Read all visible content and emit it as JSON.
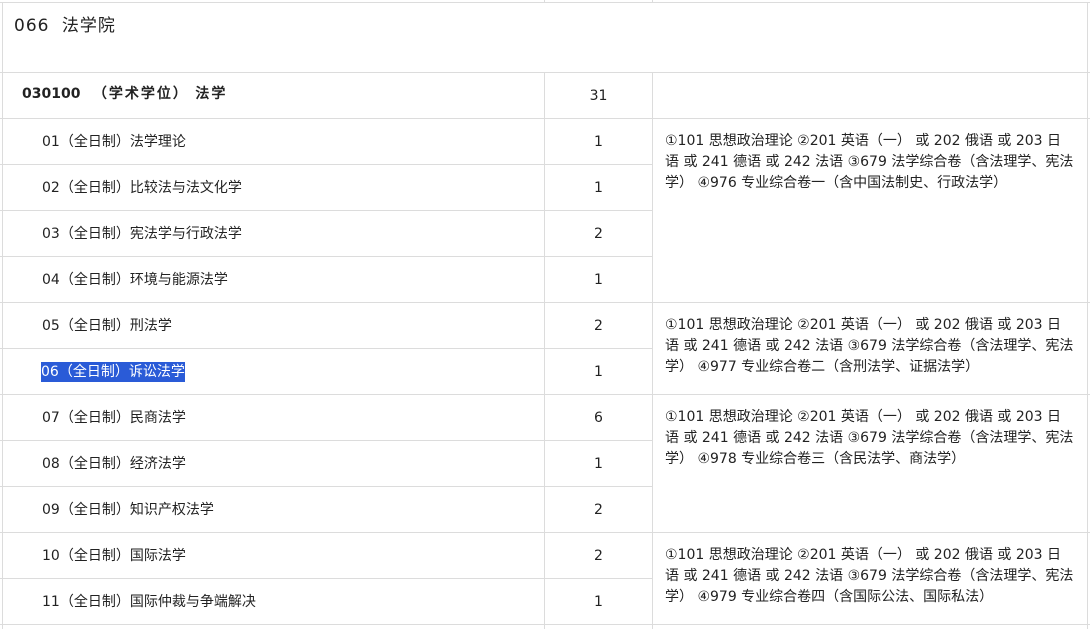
{
  "department": {
    "code": "066",
    "name": "法学院"
  },
  "major": {
    "code": "030100",
    "type": "（学术学位）",
    "name": "法学",
    "quota": "31"
  },
  "directions": [
    {
      "label": "01（全日制）法学理论",
      "quota": "1"
    },
    {
      "label": "02（全日制）比较法与法文化学",
      "quota": "1"
    },
    {
      "label": "03（全日制）宪法学与行政法学",
      "quota": "2"
    },
    {
      "label": "04（全日制）环境与能源法学",
      "quota": "1"
    },
    {
      "label": "05（全日制）刑法学",
      "quota": "2"
    },
    {
      "label": "06（全日制）诉讼法学",
      "quota": "1",
      "selected": true
    },
    {
      "label": "07（全日制）民商法学",
      "quota": "6"
    },
    {
      "label": "08（全日制）经济法学",
      "quota": "1"
    },
    {
      "label": "09（全日制）知识产权法学",
      "quota": "2"
    },
    {
      "label": "10（全日制）国际法学",
      "quota": "2"
    },
    {
      "label": "11（全日制）国际仲裁与争端解决",
      "quota": "1"
    }
  ],
  "exam_subjects": [
    "①101 思想政治理论 ②201 英语（一） 或 202 俄语 或 203 日语 或 241 德语 或 242 法语 ③679 法学综合卷（含法理学、宪法学） ④976 专业综合卷一（含中国法制史、行政法学）",
    "①101 思想政治理论 ②201 英语（一） 或 202 俄语 或 203 日语 或 241 德语 或 242 法语 ③679 法学综合卷（含法理学、宪法学） ④977 专业综合卷二（含刑法学、证据法学）",
    "①101 思想政治理论 ②201 英语（一） 或 202 俄语 或 203 日语 或 241 德语 或 242 法语 ③679 法学综合卷（含法理学、宪法学） ④978 专业综合卷三（含民法学、商法学）",
    "①101 思想政治理论 ②201 英语（一） 或 202 俄语 或 203 日语 或 241 德语 或 242 法语 ③679 法学综合卷（含法理学、宪法学） ④979 专业综合卷四（含国际公法、国际私法）"
  ]
}
